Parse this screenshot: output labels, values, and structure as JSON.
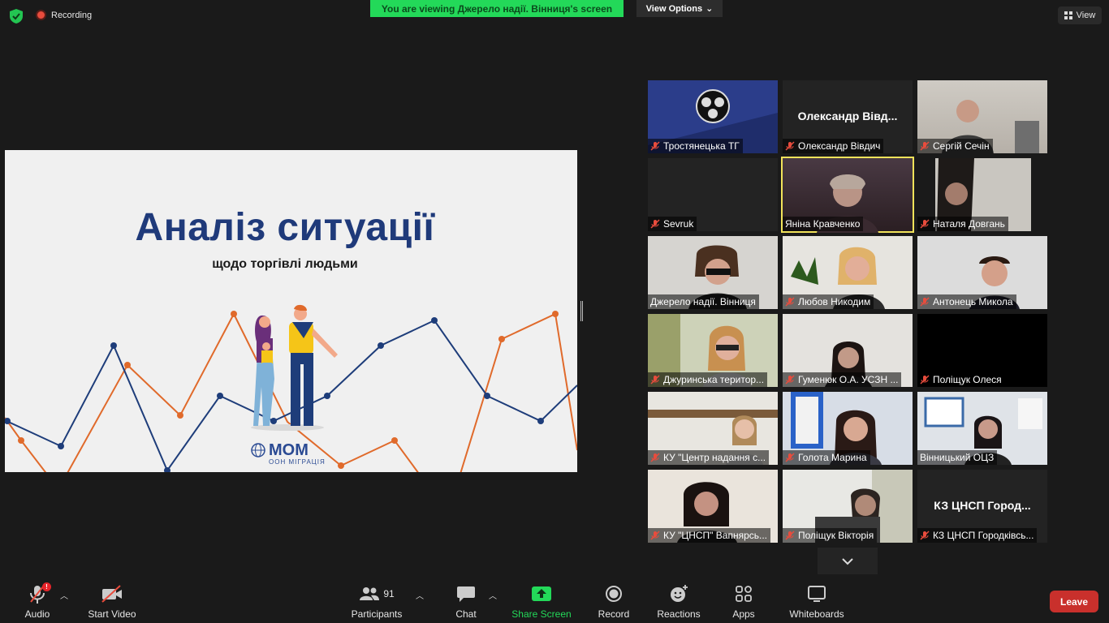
{
  "topbar": {
    "recording_label": "Recording",
    "viewing_banner": "You are viewing Джерело надії. Вінниця's screen",
    "view_options_label": "View Options",
    "view_label": "View"
  },
  "slide": {
    "title": "Аналіз ситуації",
    "subtitle": "щодо торгівлі людьми",
    "logo_main": "МОМ",
    "logo_sub": "ООН МІГРАЦІЯ"
  },
  "participants": [
    {
      "name": "Тростянецька ТГ",
      "muted": true,
      "video": "logo"
    },
    {
      "name": "Олександр Вівдич",
      "muted": true,
      "video": "off",
      "display": "Олександр  Вівд..."
    },
    {
      "name": "Сергій Сечін",
      "muted": true,
      "video": "on"
    },
    {
      "name": "Sevruk",
      "muted": true,
      "video": "off"
    },
    {
      "name": "Яніна Кравченко",
      "muted": false,
      "video": "on",
      "active": true
    },
    {
      "name": "Наталя Довгань",
      "muted": true,
      "video": "on"
    },
    {
      "name": "Джерело надії. Вінниця",
      "muted": false,
      "video": "on"
    },
    {
      "name": "Любов Никодим",
      "muted": true,
      "video": "on"
    },
    {
      "name": "Антонець Микола",
      "muted": true,
      "video": "on"
    },
    {
      "name": "Джуринська територ...",
      "muted": true,
      "video": "on"
    },
    {
      "name": "Гуменюк О.А. УСЗН ...",
      "muted": true,
      "video": "on"
    },
    {
      "name": "Поліщук Олеся",
      "muted": true,
      "video": "black"
    },
    {
      "name": "КУ \"Центр надання с...",
      "muted": true,
      "video": "on"
    },
    {
      "name": "Голота Марина",
      "muted": true,
      "video": "on"
    },
    {
      "name": "Вінницький ОЦЗ",
      "muted": false,
      "video": "on"
    },
    {
      "name": "КУ \"ЦНСП\" Вапнярсь...",
      "muted": true,
      "video": "on"
    },
    {
      "name": "Поліщук Вікторія",
      "muted": true,
      "video": "on"
    },
    {
      "name": "КЗ ЦНСП Городківсь...",
      "muted": true,
      "video": "off",
      "display": "КЗ  ЦНСП  Город..."
    }
  ],
  "toolbar": {
    "audio": "Audio",
    "start_video": "Start Video",
    "participants": "Participants",
    "participants_count": "91",
    "chat": "Chat",
    "share_screen": "Share Screen",
    "record": "Record",
    "reactions": "Reactions",
    "apps": "Apps",
    "whiteboards": "Whiteboards",
    "leave": "Leave"
  },
  "colors": {
    "share_green": "#23d959",
    "leave_red": "#c9302c",
    "slide_title_blue": "#1f3a7a",
    "chart_orange": "#e06a2b",
    "chart_navy": "#1e3d7a",
    "active_speaker": "#f2e35a"
  }
}
